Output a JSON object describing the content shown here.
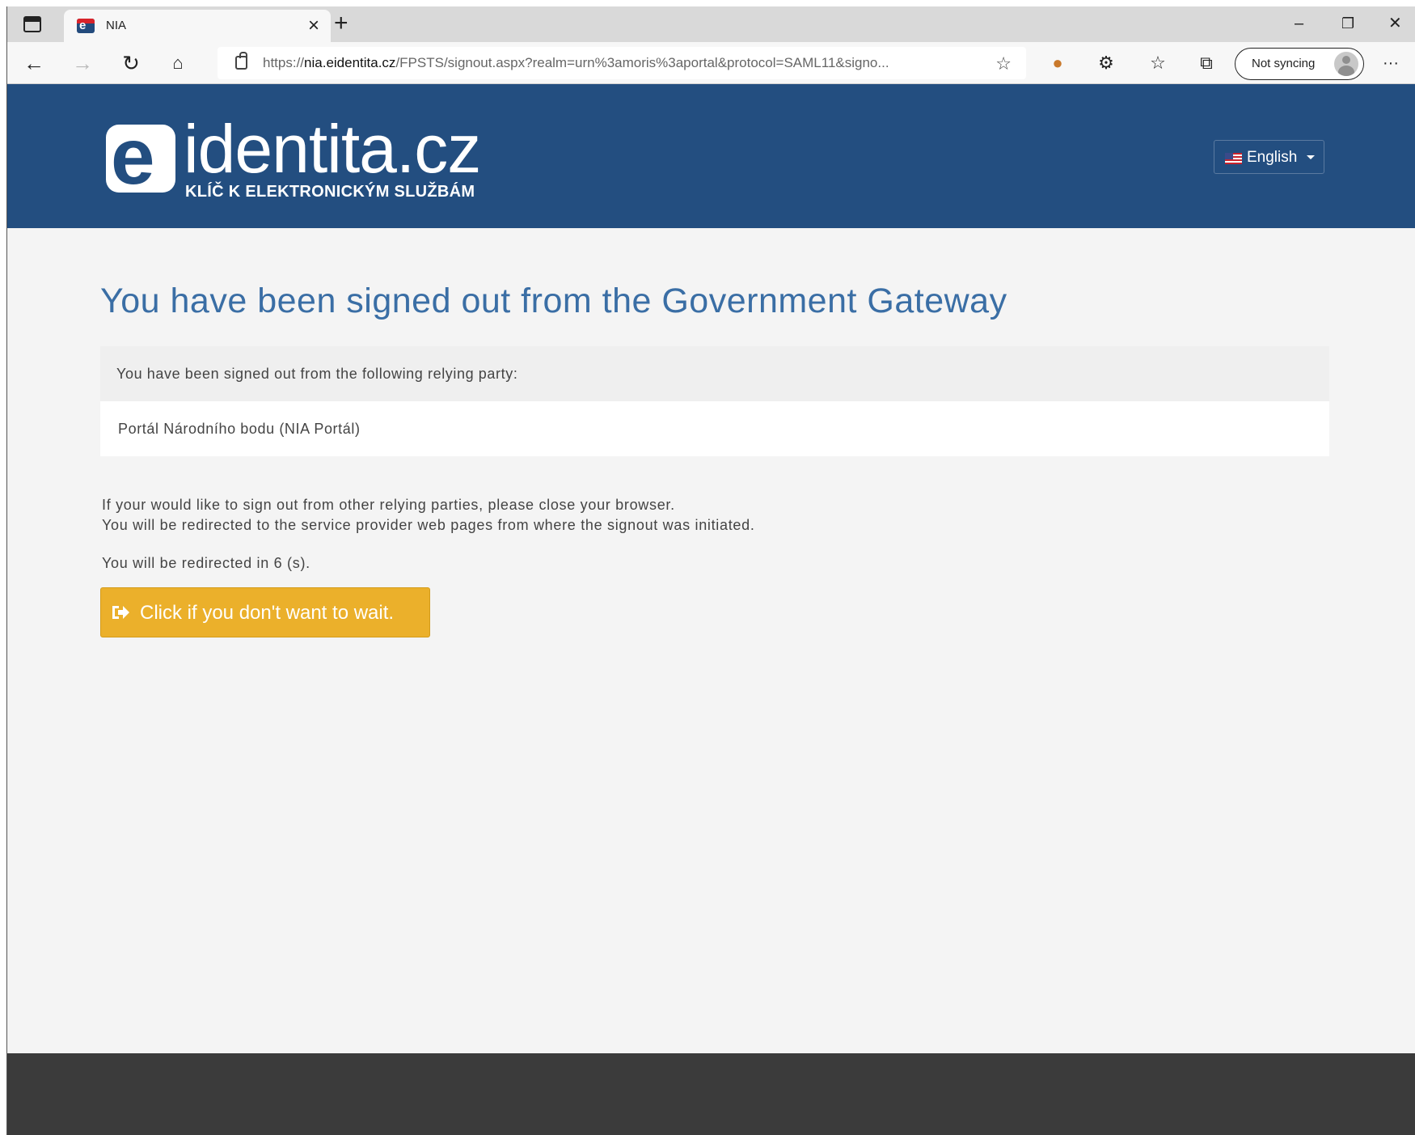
{
  "browser": {
    "tab_title": "NIA",
    "url_scheme": "https://",
    "url_host": "nia.eidentita.cz",
    "url_path": "/FPSTS/signout.aspx?realm=urn%3amoris%3aportal&protocol=SAML11&signo...",
    "sync_label": "Not syncing",
    "icons": {
      "tab_actions": "tab-actions-icon",
      "close": "close-icon",
      "new_tab": "plus-icon",
      "minimize": "minimize-icon",
      "restore": "restore-icon",
      "window_close": "close-icon",
      "back": "back-arrow-icon",
      "forward": "forward-arrow-icon",
      "refresh": "refresh-icon",
      "home": "home-icon",
      "lock": "lock-icon",
      "add_favorite": "add-favorite-icon",
      "extension": "cookie-extension-icon",
      "extensions": "puzzle-icon",
      "favorites": "favorites-icon",
      "collections": "collections-icon",
      "more": "more-icon"
    }
  },
  "header": {
    "logo_text": "identita.cz",
    "logo_mark": "e",
    "tagline": "KLÍČ K ELEKTRONICKÝM SLUŽBÁM",
    "language": "English"
  },
  "main": {
    "title": "You have been signed out from the Government Gateway",
    "relying_party_heading": "You have been signed out from the following relying party:",
    "relying_parties": [
      "Portál Národního bodu (NIA Portál)"
    ],
    "info_line1": "If your would like to sign out from other relying parties, please close your browser.",
    "info_line2": "You will be redirected to the service provider web pages from where the signout was initiated.",
    "redirect_text": "You will be redirected in 6 (s).",
    "continue_button": "Click if you don't want to wait."
  },
  "colors": {
    "header_bg": "#234e80",
    "title": "#3a6ea5",
    "button": "#ebb02b",
    "footer": "#3b3b3b",
    "page_bg": "#f4f4f4"
  }
}
